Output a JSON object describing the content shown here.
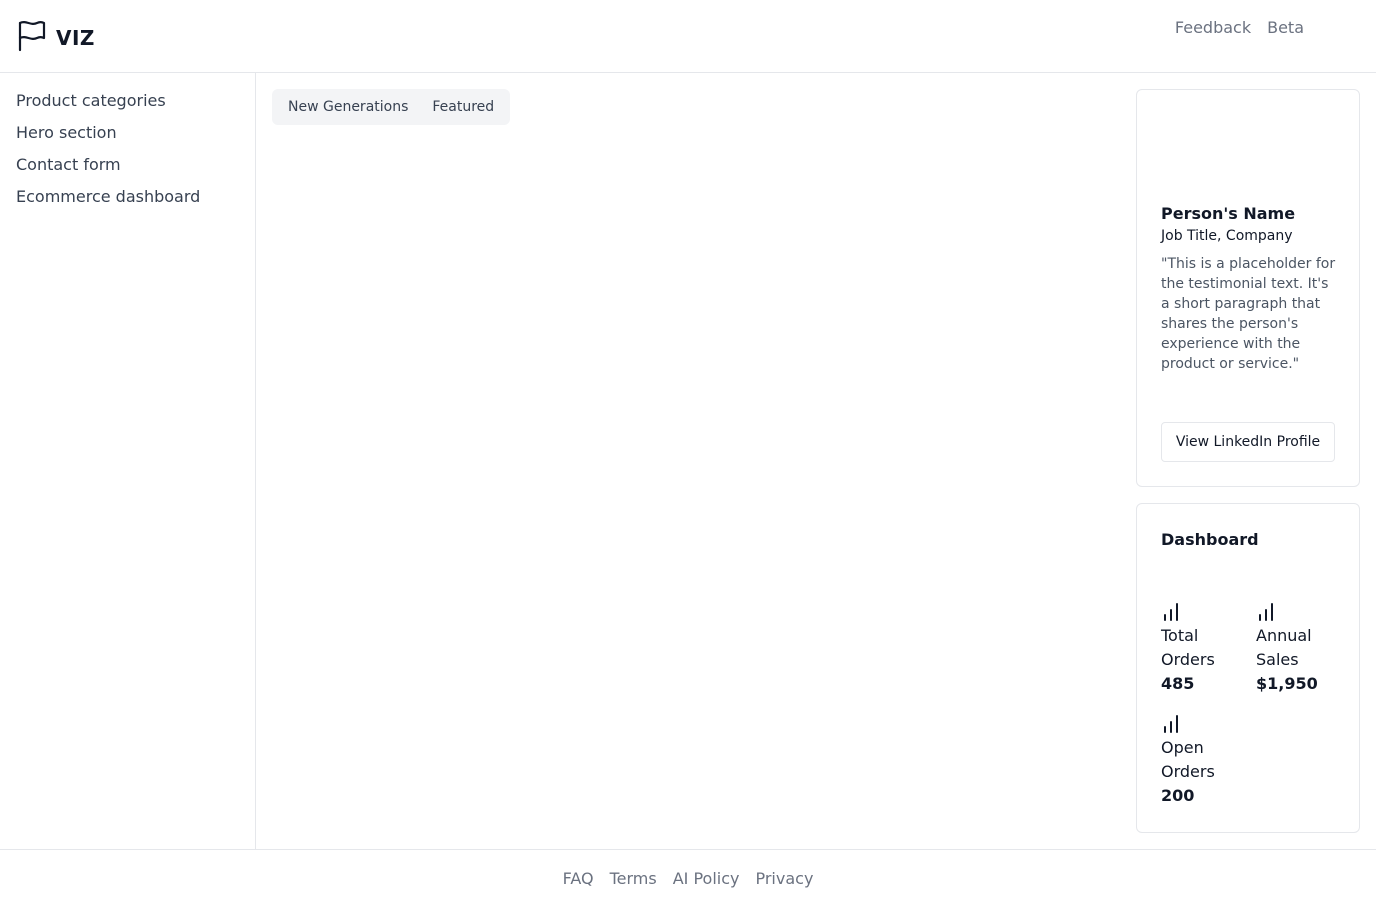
{
  "header": {
    "logo_text": "VIZ",
    "links": [
      "Feedback",
      "Beta"
    ]
  },
  "sidebar": {
    "items": [
      "Product categories",
      "Hero section",
      "Contact form",
      "Ecommerce dashboard"
    ]
  },
  "main": {
    "tabs": [
      "New Generations",
      "Featured"
    ]
  },
  "testimonial": {
    "name": "Person's Name",
    "job": "Job Title, Company",
    "quote": "\"This is a placeholder for the testimonial text. It's a short paragraph that shares the person's experience with the product or service.\"",
    "button_label": "View LinkedIn Profile"
  },
  "dashboard": {
    "title": "Dashboard",
    "stats": [
      {
        "label": "Total Orders",
        "value": "485",
        "icon": "bar-chart-icon"
      },
      {
        "label": "Annual Sales",
        "value": "$1,950",
        "icon": "bar-chart-icon"
      },
      {
        "label": "Open Orders",
        "value": "200",
        "icon": "bar-chart-icon"
      }
    ]
  },
  "footer": {
    "links": [
      "FAQ",
      "Terms",
      "AI Policy",
      "Privacy"
    ]
  },
  "icons": {
    "logo": "flag-icon"
  }
}
